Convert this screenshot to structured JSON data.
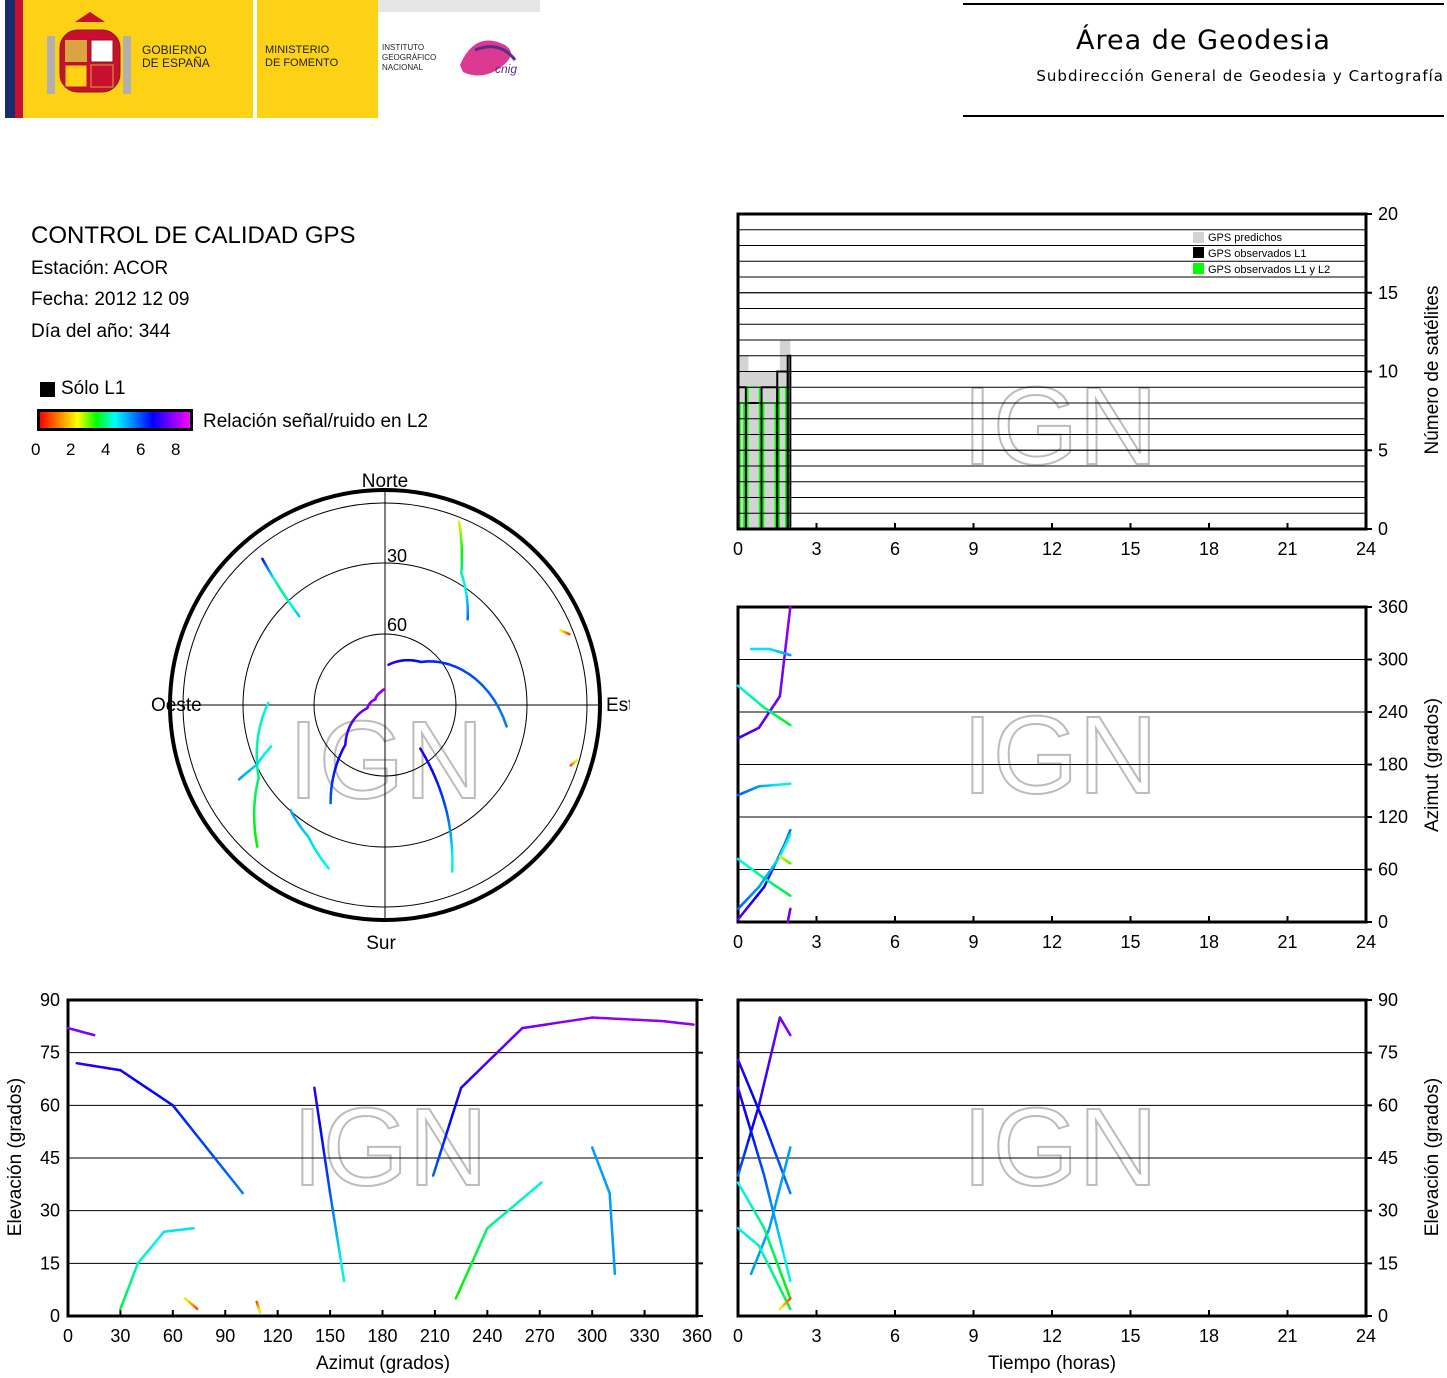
{
  "header": {
    "gov_line1": "GOBIERNO",
    "gov_line2": "DE ESPAÑA",
    "min_line1": "MINISTERIO",
    "min_line2": "DE FOMENTO",
    "ign_line1": "INSTITUTO",
    "ign_line2": "GEOGRÁFICO",
    "ign_line3": "NACIONAL",
    "cnig": "cnig",
    "area_title": "Área de Geodesia",
    "area_sub": "Subdirección General de Geodesia y Cartografía"
  },
  "info": {
    "title": "CONTROL DE CALIDAD GPS",
    "station": "Estación: ACOR",
    "date": "Fecha: 2012 12 09",
    "doy": "Día del año: 344"
  },
  "legend": {
    "l1_only": "Sólo L1",
    "snr_label": "Relación señal/ruido en L2",
    "snr_ticks": [
      "0",
      "2",
      "4",
      "6",
      "8"
    ]
  },
  "watermark": "IGN",
  "colors": {
    "predicted": "#d3d3d3",
    "observed_l1": "#000000",
    "observed_l1_l2": "#00ff00",
    "frame": "#000000"
  },
  "chart_data": [
    {
      "id": "skyplot",
      "type": "scatter",
      "labels": {
        "north": "Norte",
        "south": "Sur",
        "east": "Este",
        "west": "Oeste"
      },
      "elev_ticks": [
        "30",
        "60"
      ],
      "tracks": [
        {
          "az": [
            320,
            318,
            316
          ],
          "el": [
            5,
            20,
            35
          ],
          "snr": [
            7,
            4.5,
            5.8
          ]
        },
        {
          "az": [
            22,
            30,
            44
          ],
          "el": [
            2,
            22,
            37
          ],
          "snr": [
            2,
            4.8,
            6.4
          ]
        },
        {
          "az": [
            67,
            69
          ],
          "el": [
            5,
            2
          ],
          "snr": [
            2,
            0.5
          ]
        },
        {
          "az": [
            108,
            106
          ],
          "el": [
            3,
            1
          ],
          "snr": [
            0.5,
            2
          ]
        },
        {
          "az": [
            5,
            40,
            100
          ],
          "el": [
            72,
            65,
            35
          ],
          "snr": [
            7.5,
            7,
            6.2
          ]
        },
        {
          "az": [
            141,
            150,
            158
          ],
          "el": [
            65,
            35,
            10
          ],
          "snr": [
            7.5,
            6.5,
            5
          ]
        },
        {
          "az": [
            209,
            225,
            260,
            300,
            340,
            358
          ],
          "el": [
            40,
            65,
            82,
            85,
            84,
            83
          ],
          "snr": [
            6.5,
            7.5,
            8,
            8.2,
            8.2,
            8.2
          ]
        },
        {
          "az": [
            222,
            240,
            271
          ],
          "el": [
            5,
            25,
            38
          ],
          "snr": [
            3.5,
            4.5,
            5.3
          ]
        },
        {
          "az": [
            199,
            210,
            222
          ],
          "el": [
            13,
            22,
            27
          ],
          "snr": [
            5.3,
            5.6,
            6
          ]
        },
        {
          "az": [
            243,
            245,
            250
          ],
          "el": [
            17,
            27,
            36
          ],
          "snr": [
            6,
            5.6,
            5.2
          ]
        }
      ]
    },
    {
      "id": "sat_count",
      "type": "bar",
      "ylabel": "Número de satélites",
      "xlim": [
        0,
        24
      ],
      "ylim": [
        0,
        20
      ],
      "xticks": [
        0,
        3,
        6,
        9,
        12,
        15,
        18,
        21,
        24
      ],
      "yticks": [
        0,
        5,
        10,
        15,
        20
      ],
      "legend": [
        "GPS predichos",
        "GPS observados L1",
        "GPS observados L1 y L2"
      ],
      "predicted": [
        [
          0,
          0.4,
          11
        ],
        [
          0.4,
          1.6,
          10
        ],
        [
          1.6,
          2.0,
          12
        ]
      ],
      "observed_l1": [
        [
          0,
          0.3,
          9
        ],
        [
          0.3,
          0.9,
          8
        ],
        [
          0.9,
          1.5,
          9
        ],
        [
          1.5,
          1.9,
          10
        ],
        [
          1.9,
          2.0,
          11
        ]
      ],
      "observed_l1_l2": [
        [
          0,
          0.3,
          8
        ],
        [
          0.3,
          0.9,
          9
        ],
        [
          0.9,
          1.5,
          8
        ],
        [
          1.5,
          1.9,
          9
        ],
        [
          1.9,
          2.0,
          11
        ]
      ]
    },
    {
      "id": "azimuth_time",
      "type": "line",
      "ylabel": "Azimut (grados)",
      "xlim": [
        0,
        24
      ],
      "ylim": [
        0,
        360
      ],
      "xticks": [
        0,
        3,
        6,
        9,
        12,
        15,
        18,
        21,
        24
      ],
      "yticks": [
        0,
        60,
        120,
        180,
        240,
        300,
        360
      ],
      "series": [
        {
          "t": [
            0,
            0.8,
            1.6,
            2.0
          ],
          "v": [
            210,
            222,
            258,
            360
          ],
          "snr": [
            7.5,
            7.8,
            8,
            8.2
          ]
        },
        {
          "t": [
            0,
            1.0,
            2.0
          ],
          "v": [
            270,
            245,
            225
          ],
          "snr": [
            5.3,
            4.5,
            3.8
          ]
        },
        {
          "t": [
            0.5,
            1.2,
            2.0
          ],
          "v": [
            312,
            312,
            305
          ],
          "snr": [
            5.5,
            5.5,
            6
          ]
        },
        {
          "t": [
            0,
            0.8,
            2.0
          ],
          "v": [
            145,
            155,
            158
          ],
          "snr": [
            6.5,
            6,
            5
          ]
        },
        {
          "t": [
            0,
            1.0,
            1.8,
            2.0
          ],
          "v": [
            3,
            40,
            90,
            105
          ],
          "snr": [
            7.8,
            7,
            6.5,
            6.2
          ]
        },
        {
          "t": [
            0,
            1.0,
            2.0
          ],
          "v": [
            72,
            50,
            30
          ],
          "snr": [
            5.5,
            4.5,
            4
          ]
        },
        {
          "t": [
            0,
            0.8,
            1.6,
            2.0
          ],
          "v": [
            15,
            40,
            75,
            100
          ],
          "snr": [
            6.5,
            6,
            5.5,
            5
          ]
        },
        {
          "t": [
            1.6,
            2.0
          ],
          "v": [
            75,
            67
          ],
          "snr": [
            2,
            3
          ]
        },
        {
          "t": [
            1.9,
            2.0
          ],
          "v": [
            0,
            15
          ],
          "snr": [
            8,
            8
          ]
        }
      ]
    },
    {
      "id": "elev_az",
      "type": "line",
      "xlabel": "Azimut (grados)",
      "ylabel": "Elevación (grados)",
      "xlim": [
        0,
        360
      ],
      "ylim": [
        0,
        90
      ],
      "xticks": [
        0,
        30,
        60,
        90,
        120,
        150,
        180,
        210,
        240,
        270,
        300,
        330,
        360
      ],
      "yticks": [
        0,
        15,
        30,
        45,
        60,
        75,
        90
      ],
      "series": [
        {
          "az": [
            0,
            15
          ],
          "el": [
            82,
            80
          ],
          "snr": [
            8.2,
            8
          ]
        },
        {
          "az": [
            5,
            30,
            60,
            100
          ],
          "el": [
            72,
            70,
            60,
            35
          ],
          "snr": [
            7.5,
            7.3,
            7,
            6.2
          ]
        },
        {
          "az": [
            141,
            150,
            158
          ],
          "el": [
            65,
            35,
            10
          ],
          "snr": [
            7.5,
            6.5,
            5
          ]
        },
        {
          "az": [
            209,
            225,
            260,
            300,
            340,
            358
          ],
          "el": [
            40,
            65,
            82,
            85,
            84,
            83
          ],
          "snr": [
            6.5,
            7.5,
            8,
            8.2,
            8.2,
            8.2
          ]
        },
        {
          "az": [
            30,
            40,
            55,
            72
          ],
          "el": [
            2,
            15,
            24,
            25
          ],
          "snr": [
            4,
            5,
            5.5,
            5.5
          ]
        },
        {
          "az": [
            67,
            74
          ],
          "el": [
            5,
            2
          ],
          "snr": [
            2,
            0.5
          ]
        },
        {
          "az": [
            108,
            110
          ],
          "el": [
            4,
            1
          ],
          "snr": [
            0.5,
            2
          ]
        },
        {
          "az": [
            222,
            240,
            271
          ],
          "el": [
            5,
            25,
            38
          ],
          "snr": [
            3.5,
            4.5,
            5.3
          ]
        },
        {
          "az": [
            300,
            310,
            313
          ],
          "el": [
            48,
            35,
            12
          ],
          "snr": [
            6,
            6,
            6
          ]
        }
      ]
    },
    {
      "id": "elev_time",
      "type": "line",
      "xlabel": "Tiempo (horas)",
      "ylabel": "Elevación (grados)",
      "xlim": [
        0,
        24
      ],
      "ylim": [
        0,
        90
      ],
      "xticks": [
        0,
        3,
        6,
        9,
        12,
        15,
        18,
        21,
        24
      ],
      "yticks": [
        0,
        15,
        30,
        45,
        60,
        75,
        90
      ],
      "series": [
        {
          "t": [
            0,
            0.8,
            1.6,
            2.0
          ],
          "v": [
            40,
            60,
            85,
            80
          ],
          "snr": [
            6.5,
            7.5,
            8,
            8.2
          ]
        },
        {
          "t": [
            0,
            1.0,
            2.0
          ],
          "v": [
            73,
            55,
            35
          ],
          "snr": [
            7.5,
            7,
            6.2
          ]
        },
        {
          "t": [
            0,
            1.0,
            2.0
          ],
          "v": [
            65,
            40,
            10
          ],
          "snr": [
            7.5,
            6.5,
            5
          ]
        },
        {
          "t": [
            0.5,
            1.2,
            2.0
          ],
          "v": [
            12,
            25,
            48
          ],
          "snr": [
            6,
            6,
            6
          ]
        },
        {
          "t": [
            0,
            1.0,
            2.0
          ],
          "v": [
            38,
            25,
            5
          ],
          "snr": [
            5.3,
            4.5,
            3.5
          ]
        },
        {
          "t": [
            0,
            0.8,
            2.0
          ],
          "v": [
            25,
            20,
            2
          ],
          "snr": [
            5.5,
            5,
            4
          ]
        },
        {
          "t": [
            1.6,
            2.0
          ],
          "v": [
            2,
            5
          ],
          "snr": [
            2,
            0.5
          ]
        }
      ]
    }
  ]
}
